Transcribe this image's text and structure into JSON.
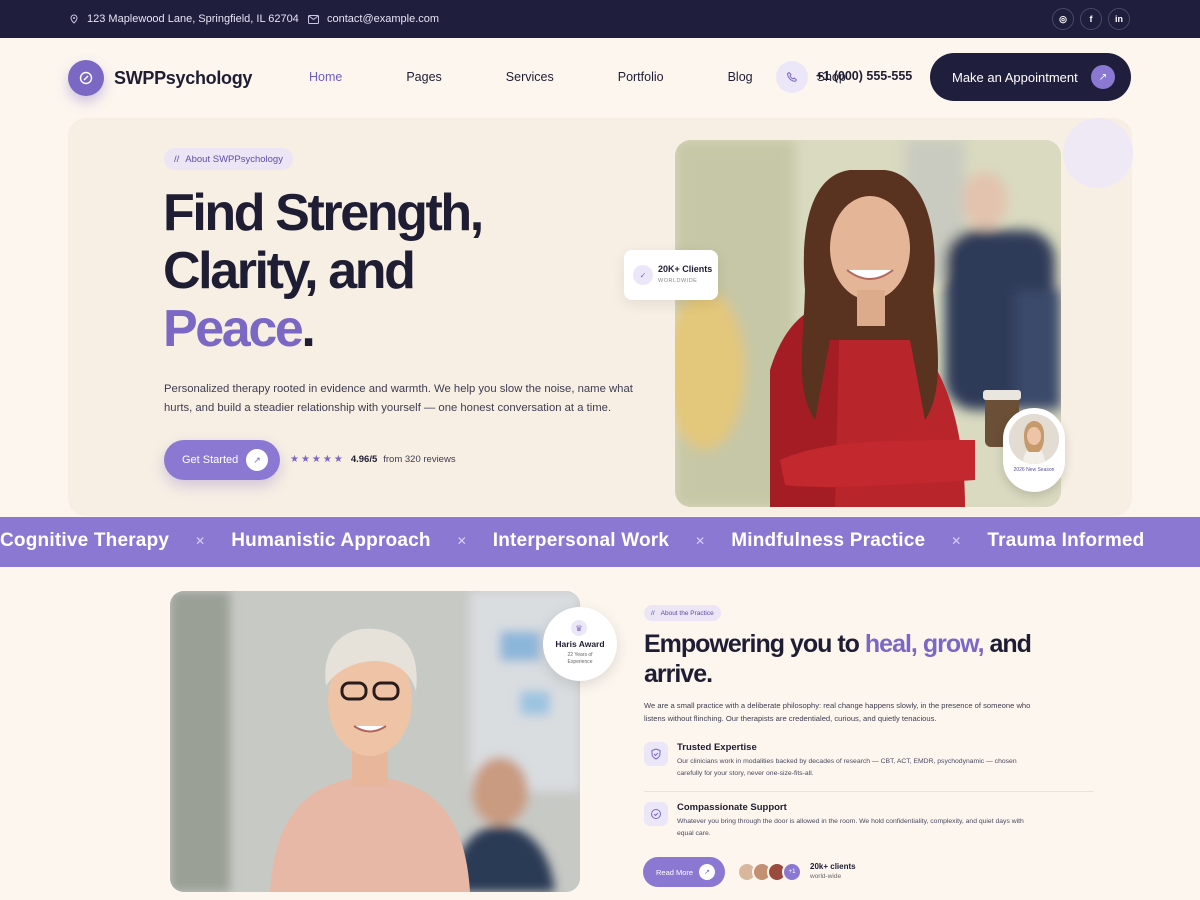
{
  "topbar": {
    "address": "123 Maplewood Lane, Springfield, IL 62704",
    "email": "contact@example.com",
    "socials": [
      "instagram-icon",
      "facebook-icon",
      "linkedin-icon"
    ],
    "social_glyphs": [
      "◎",
      "f",
      "in"
    ]
  },
  "nav": {
    "brand": "SWPPsychology",
    "menu": [
      "Home",
      "Pages",
      "Services",
      "Portfolio",
      "Blog",
      "Shop"
    ],
    "active": "Home",
    "phone": "+1 (000) 555-555",
    "cta": "Make an Appointment"
  },
  "hero": {
    "eyebrow": "About SWPPsychology",
    "title_line1": "Find Strength,",
    "title_line2": "Clarity, and",
    "title_accent": "Peace",
    "title_dot": ".",
    "description": "Personalized therapy rooted in evidence and warmth. We help you slow the noise, name what hurts, and build a steadier relationship with yourself — one honest conversation at a time.",
    "cta": "Get Started",
    "stars": "★★★★★",
    "rating_value": "4.96/5",
    "rating_text": "from 320 reviews",
    "clients_title": "20K+ Clients",
    "clients_sub": "WORLDWIDE",
    "season_label": "2026 New Season"
  },
  "marquee": [
    "Cognitive Therapy",
    "Humanistic Approach",
    "Interpersonal Work",
    "Mindfulness Practice",
    "Trauma Informed"
  ],
  "about": {
    "eyebrow": "About the Practice",
    "title_pre": "Empowering you to ",
    "title_accent": "heal, grow,",
    "title_post": " and arrive.",
    "description": "We are a small practice with a deliberate philosophy: real change happens slowly, in the presence of someone who listens without flinching. Our therapists are credentialed, curious, and quietly tenacious.",
    "award_title": "Haris Award",
    "award_sub": "22 Years of Experience",
    "features": [
      {
        "title": "Trusted Expertise",
        "text": "Our clinicians work in modalities backed by decades of research — CBT, ACT, EMDR, psychodynamic — chosen carefully for your story, never one-size-fits-all."
      },
      {
        "title": "Compassionate Support",
        "text": "Whatever you bring through the door is allowed in the room. We hold confidentiality, complexity, and quiet days with equal care."
      }
    ],
    "cta": "Read More",
    "plus_badge": "+1",
    "clients_count": "20k+ clients",
    "clients_sub": "world-wide"
  },
  "colors": {
    "accent": "#7b68c4",
    "dark": "#1f1e3d",
    "background": "#fcf6ef",
    "marquee": "#8b78d3"
  }
}
